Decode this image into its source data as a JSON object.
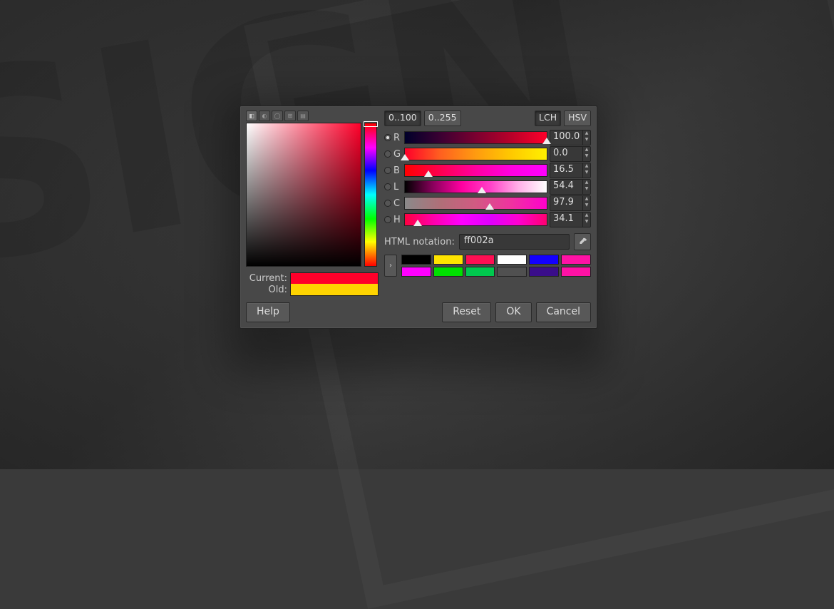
{
  "range": {
    "scale100": "0..100",
    "scale255": "0..255"
  },
  "model": {
    "lch": "LCH",
    "hsv": "HSV"
  },
  "channels": [
    {
      "key": "R",
      "label": "R",
      "value": "100.0",
      "selected": true,
      "gradientClass": "grad-r",
      "markerPct": 100
    },
    {
      "key": "G",
      "label": "G",
      "value": "0.0",
      "selected": false,
      "gradientClass": "grad-g",
      "markerPct": 0
    },
    {
      "key": "B",
      "label": "B",
      "value": "16.5",
      "selected": false,
      "gradientClass": "grad-b",
      "markerPct": 16.5
    },
    {
      "key": "L",
      "label": "L",
      "value": "54.4",
      "selected": false,
      "gradientClass": "grad-l",
      "markerPct": 54.4
    },
    {
      "key": "C",
      "label": "C",
      "value": "97.9",
      "selected": false,
      "gradientClass": "grad-c",
      "markerPct": 60
    },
    {
      "key": "H",
      "label": "H",
      "value": "34.1",
      "selected": false,
      "gradientClass": "grad-h",
      "markerPct": 9
    }
  ],
  "currentLabel": "Current:",
  "oldLabel": "Old:",
  "currentColor": "#ff002a",
  "oldColor": "#ffd400",
  "htmlLabel": "HTML notation:",
  "htmlValue": "ff002a",
  "swatches": [
    "#000000",
    "#ffe400",
    "#ff0f53",
    "#ffffff",
    "#1300ff",
    "#ff12a5",
    "#ff00ff",
    "#00e000",
    "#00c84e",
    "#505050",
    "#3a0d8a",
    "#ff12a5"
  ],
  "buttons": {
    "help": "Help",
    "reset": "Reset",
    "ok": "OK",
    "cancel": "Cancel"
  }
}
